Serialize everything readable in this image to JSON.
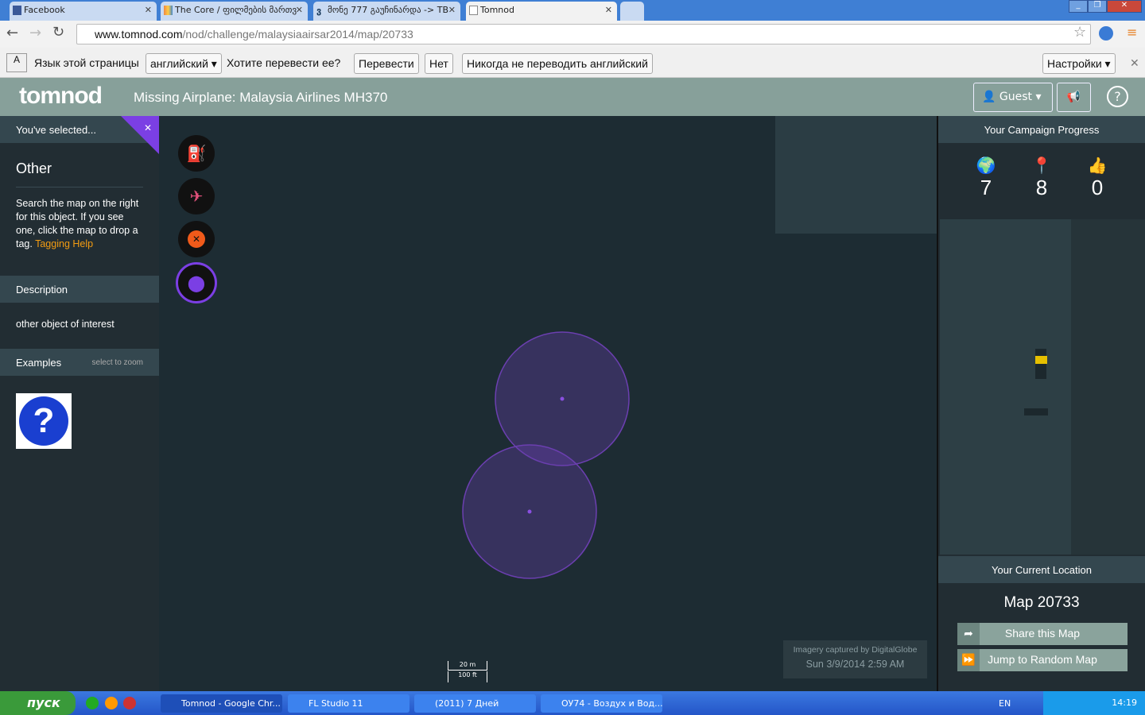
{
  "browser": {
    "tabs": [
      {
        "label": "Facebook"
      },
      {
        "label": "The Core / ფილმების მართვ"
      },
      {
        "label": "მონე 777 გაუჩინარდა -> TB"
      },
      {
        "label": "Tomnod"
      }
    ],
    "url_host": "www.tomnod.com",
    "url_path": "/nod/challenge/malaysiaairsar2014/map/20733"
  },
  "translate": {
    "lang_label": "Язык этой страницы",
    "lang_value": "английский",
    "question": "Хотите перевести ее?",
    "translate": "Перевести",
    "no": "Нет",
    "never": "Никогда не переводить английский",
    "settings": "Настройки"
  },
  "header": {
    "logo": "tomnod",
    "title": "Missing Airplane: Malaysia Airlines MH370",
    "guest": "Guest",
    "help": "?"
  },
  "left": {
    "selected": "You've selected...",
    "type": "Other",
    "instructions": "Search the map on the right for this object. If you see one, click the map to drop a tag.",
    "help_link": "Tagging Help",
    "description_label": "Description",
    "description": "other object of interest",
    "examples_label": "Examples",
    "examples_hint": "select to zoom"
  },
  "tools": [
    "fuel-icon",
    "airplane-crash-icon",
    "cancel-icon",
    "map-pin-icon"
  ],
  "map": {
    "attribution": "Imagery captured by DigitalGlobe",
    "date": "Sun 3/9/2014 2:59 AM",
    "scale_m": "20 m",
    "scale_ft": "100 ft",
    "tag_color": "#6b3fb0"
  },
  "right": {
    "progress_title": "Your Campaign Progress",
    "maps": "7",
    "tags": "8",
    "votes": "0",
    "location_title": "Your Current Location",
    "map_name": "Map 20733",
    "share": "Share this Map",
    "jump": "Jump to Random Map"
  },
  "taskbar": {
    "start": "пуск",
    "tasks": [
      "Tomnod - Google Chr...",
      "FL Studio 11",
      "(2011) 7 Дней",
      "ОУ74 - Воздух и Вод..."
    ],
    "lang": "EN",
    "time": "14:19"
  }
}
